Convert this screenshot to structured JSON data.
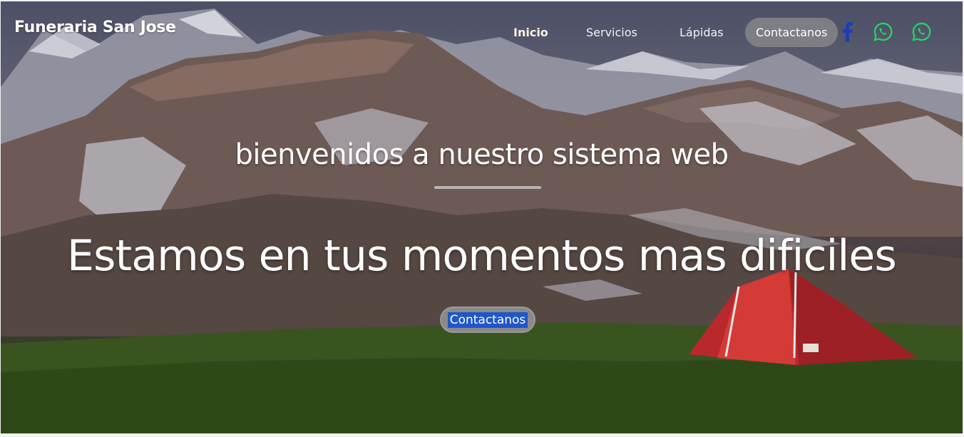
{
  "brand": {
    "name": "Funeraria San Jose"
  },
  "nav": {
    "items": [
      {
        "label": "Inicio"
      },
      {
        "label": "Servicios"
      },
      {
        "label": "Lápidas"
      },
      {
        "label": "Contactanos"
      }
    ]
  },
  "social": {
    "icons": [
      "facebook-icon",
      "whatsapp-icon",
      "whatsapp-icon"
    ],
    "colors": {
      "facebook": "#1e3fb0",
      "whatsapp": "#25d366"
    }
  },
  "hero": {
    "subtitle": "bienvenidos a nuestro sistema web",
    "title": "Estamos en tus momentos mas dificiles",
    "cta_label": "Contactanos"
  }
}
